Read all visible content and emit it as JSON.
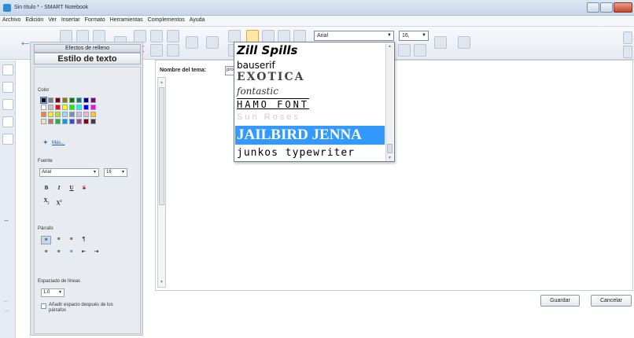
{
  "window": {
    "title": "Sin título * - SMART Notebook"
  },
  "menu": [
    "Archivo",
    "Edición",
    "Ver",
    "Insertar",
    "Formato",
    "Herramientas",
    "Complementos",
    "Ayuda"
  ],
  "toolbar": {
    "font_value": "Arial",
    "size_value": "16,"
  },
  "panel": {
    "effects_tab": "Efectos de relleno",
    "text_tab": "Estilo de texto",
    "color_label": "Color",
    "more_link": "Más...",
    "font_label": "Fuente",
    "font_value": "Arial",
    "size_value": "16",
    "bold": "B",
    "italic": "I",
    "underline": "U",
    "strike": "S",
    "subscript": "X",
    "subscript_mark": "2",
    "superscript": "X",
    "superscript_mark": "2",
    "paragraph_label": "Párrafo",
    "line_spacing_label": "Espaciado de líneas",
    "line_spacing_value": "1.0",
    "add_space_label": "Añadir espacio después de los párrafos"
  },
  "palette": [
    [
      "#000000",
      "#7f7f7f",
      "#7f0000",
      "#7f7f00",
      "#007f00",
      "#007f7f",
      "#00007f",
      "#7f007f"
    ],
    [
      "#ffffff",
      "#c3c3c3",
      "#ff0000",
      "#ffff00",
      "#00ff00",
      "#00ffff",
      "#0000ff",
      "#ff00ff"
    ],
    [
      "#ff7f27",
      "#fff200",
      "#b5e61d",
      "#99d9ea",
      "#7092be",
      "#c8bfe7",
      "#ffaec9",
      "#ffc90e"
    ],
    [
      "#efe4b0",
      "#b97a57",
      "#22b14c",
      "#00a2e8",
      "#3f48cc",
      "#a349a4",
      "#880015",
      "#404040"
    ]
  ],
  "main": {
    "theme_label": "Nombre del tema:",
    "theme_value": "pro",
    "save_label": "Guardar",
    "cancel_label": "Cancelar"
  },
  "font_list": {
    "items": [
      {
        "label": "Zill Spills"
      },
      {
        "label": "bauserif"
      },
      {
        "label": "EXOTICA"
      },
      {
        "label": "fontastic"
      },
      {
        "label": "HAMO FONT"
      },
      {
        "label": "Sun Roses"
      },
      {
        "label": "JAILBIRD JENNA",
        "selected": true
      },
      {
        "label": "junkos typewriter"
      }
    ]
  },
  "colors": {
    "selection_blue": "#3399ff",
    "accent_blue": "#2b7fd0"
  }
}
